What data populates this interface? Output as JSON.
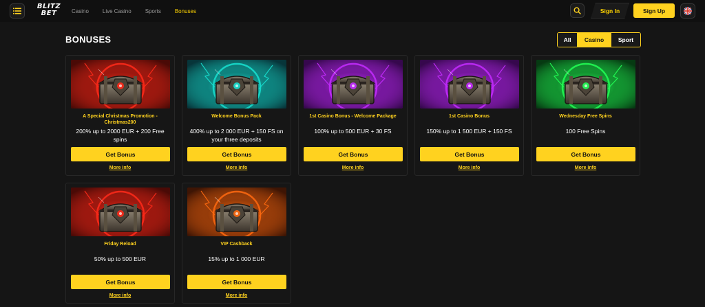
{
  "header": {
    "logo_line1": "BLITZ",
    "logo_line2": "BET",
    "nav": [
      "Casino",
      "Live Casino",
      "Sports",
      "Bonuses"
    ],
    "active_nav": "Bonuses",
    "sign_in": "Sign In",
    "sign_up": "Sign Up"
  },
  "page": {
    "title": "BONUSES",
    "filters": [
      "All",
      "Casino",
      "Sport"
    ],
    "active_filter": "Casino"
  },
  "colors": {
    "accent": "#ffd21f",
    "background": "#151515",
    "card": "#161616"
  },
  "cards": [
    {
      "title": "A Special Christmas Promotion - Christmas200",
      "desc": "200% up to 2000 EUR + 200 Free spins",
      "button": "Get Bonus",
      "more": "More info",
      "theme": "red",
      "glow": "#ff2a1a",
      "bg": "#4a0a06"
    },
    {
      "title": "Welcome Bonus Pack",
      "desc": "400% up to 2 000 EUR + 150 FS on your three deposits",
      "button": "Get Bonus",
      "more": "More info",
      "theme": "teal",
      "glow": "#17e0d0",
      "bg": "#07353a"
    },
    {
      "title": "1st Casino Bonus - Welcome Package",
      "desc": "100% up to 500 EUR + 30 FS",
      "button": "Get Bonus",
      "more": "More info",
      "theme": "purple",
      "glow": "#c42cff",
      "bg": "#36084d"
    },
    {
      "title": "1st Casino Bonus",
      "desc": "150% up to 1 500 EUR + 150 FS",
      "button": "Get Bonus",
      "more": "More info",
      "theme": "purple",
      "glow": "#c42cff",
      "bg": "#36084d"
    },
    {
      "title": "Wednesday Free Spins",
      "desc": "100 Free Spins",
      "button": "Get Bonus",
      "more": "More info",
      "theme": "green",
      "glow": "#22ff55",
      "bg": "#063a12"
    },
    {
      "title": "Friday Reload",
      "desc": "50% up to 500 EUR",
      "button": "Get Bonus",
      "more": "More info",
      "theme": "red",
      "glow": "#ff2a1a",
      "bg": "#4a0a06"
    },
    {
      "title": "VIP Cashback",
      "desc": "15% up to 1 000 EUR",
      "button": "Get Bonus",
      "more": "More info",
      "theme": "orange",
      "glow": "#ff6a10",
      "bg": "#3e1504"
    }
  ]
}
